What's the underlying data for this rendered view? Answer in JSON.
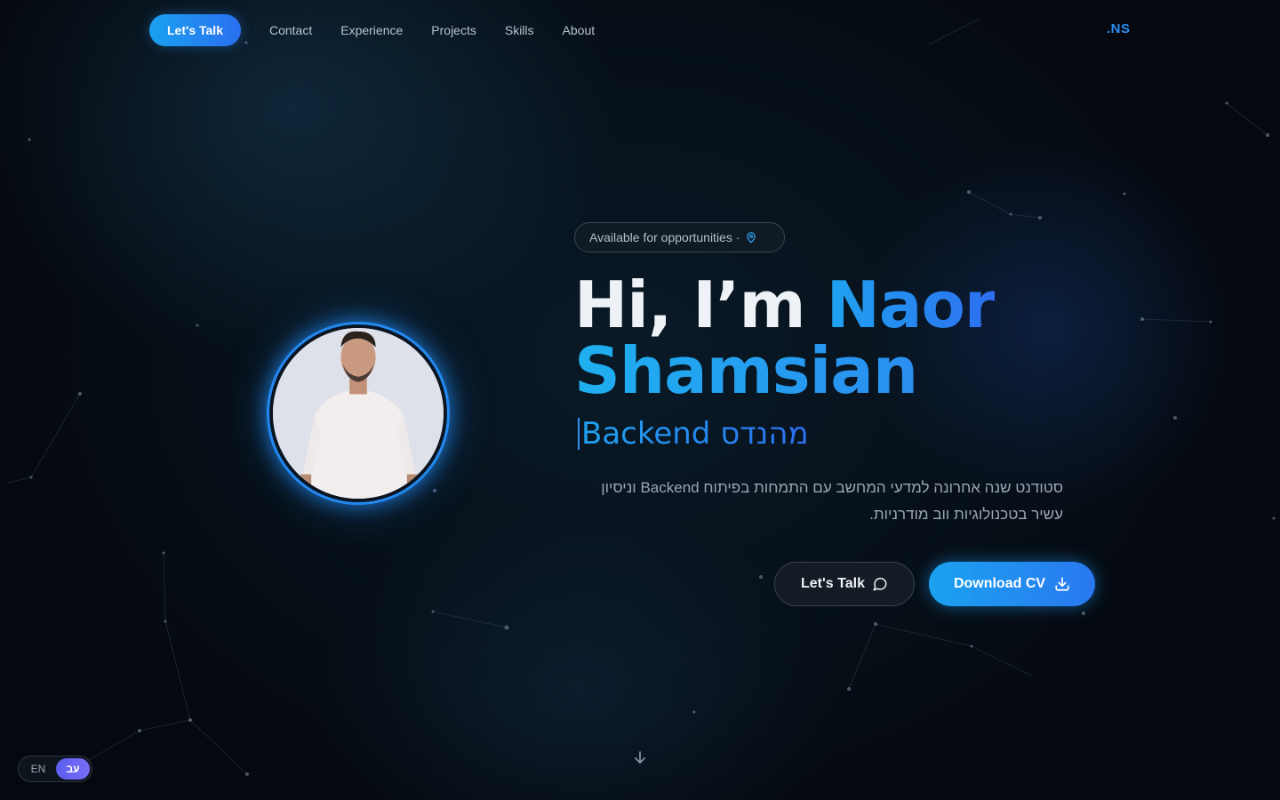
{
  "nav": {
    "cta_label": "Let's Talk",
    "links": [
      "Contact",
      "Experience",
      "Projects",
      "Skills",
      "About"
    ],
    "logo": ".NS"
  },
  "hero": {
    "badge_text": "Available for opportunities ·",
    "badge_icon": "map-pin-icon",
    "greeting": "Hi, I’m ",
    "first_name": "Naor",
    "last_name": "Shamsian",
    "role": "Backend מהנדס",
    "description": "סטודנט שנה אחרונה למדעי המחשב עם התמחות בפיתוח Backend וניסיון עשיר בטכנולוגיות ווב מודרניות.",
    "talk_button": "Let's Talk",
    "talk_icon": "chat-bubble-icon",
    "cv_button": "Download CV",
    "cv_icon": "download-icon",
    "scroll_icon": "arrow-down-icon"
  },
  "language": {
    "en": "EN",
    "he": "עב",
    "active": "he"
  },
  "colors": {
    "accent": "#2389f0",
    "accent_light": "#1fa3f0",
    "background": "#05090f",
    "lang_active": "#6a66f2"
  }
}
